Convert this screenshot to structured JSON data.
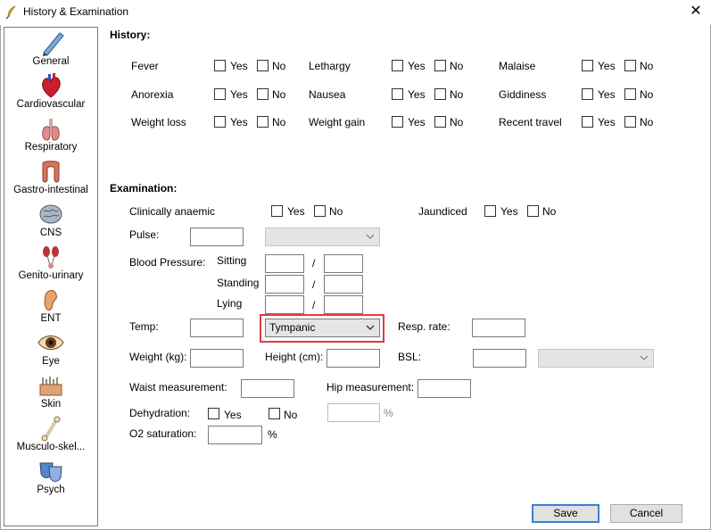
{
  "window": {
    "title": "History & Examination",
    "close": "✕"
  },
  "sidebar": {
    "items": [
      {
        "label": "General",
        "icon": "pencil-icon"
      },
      {
        "label": "Cardiovascular",
        "icon": "heart-icon"
      },
      {
        "label": "Respiratory",
        "icon": "lungs-icon"
      },
      {
        "label": "Gastro-intestinal",
        "icon": "intestine-icon"
      },
      {
        "label": "CNS",
        "icon": "brain-icon"
      },
      {
        "label": "Genito-urinary",
        "icon": "kidney-icon"
      },
      {
        "label": "ENT",
        "icon": "ear-icon"
      },
      {
        "label": "Eye",
        "icon": "eye-icon"
      },
      {
        "label": "Skin",
        "icon": "skin-icon"
      },
      {
        "label": "Musculo-skel...",
        "icon": "bone-icon"
      },
      {
        "label": "Psych",
        "icon": "masks-icon"
      }
    ]
  },
  "history": {
    "title": "History:",
    "items": [
      {
        "label": "Fever"
      },
      {
        "label": "Lethargy"
      },
      {
        "label": "Malaise"
      },
      {
        "label": "Anorexia"
      },
      {
        "label": "Nausea"
      },
      {
        "label": "Giddiness"
      },
      {
        "label": "Weight loss"
      },
      {
        "label": "Weight gain"
      },
      {
        "label": "Recent travel"
      }
    ],
    "yes": "Yes",
    "no": "No"
  },
  "examination": {
    "title": "Examination:",
    "anaemic": "Clinically anaemic",
    "jaundiced": "Jaundiced",
    "yes": "Yes",
    "no": "No",
    "pulse": "Pulse:",
    "bp": "Blood Pressure:",
    "sitting": "Sitting",
    "standing": "Standing",
    "lying": "Lying",
    "slash": "/",
    "temp": "Temp:",
    "temp_method": "Tympanic",
    "resp_rate": "Resp. rate:",
    "weight": "Weight (kg):",
    "height": "Height (cm):",
    "bsl": "BSL:",
    "waist": "Waist measurement:",
    "hip": "Hip measurement:",
    "dehydration": "Dehydration:",
    "percent": "%",
    "o2": "O2 saturation:"
  },
  "buttons": {
    "save": "Save",
    "cancel": "Cancel"
  },
  "colors": {
    "highlight": "#e03c3c",
    "default_button_border": "#3c7fd1"
  }
}
